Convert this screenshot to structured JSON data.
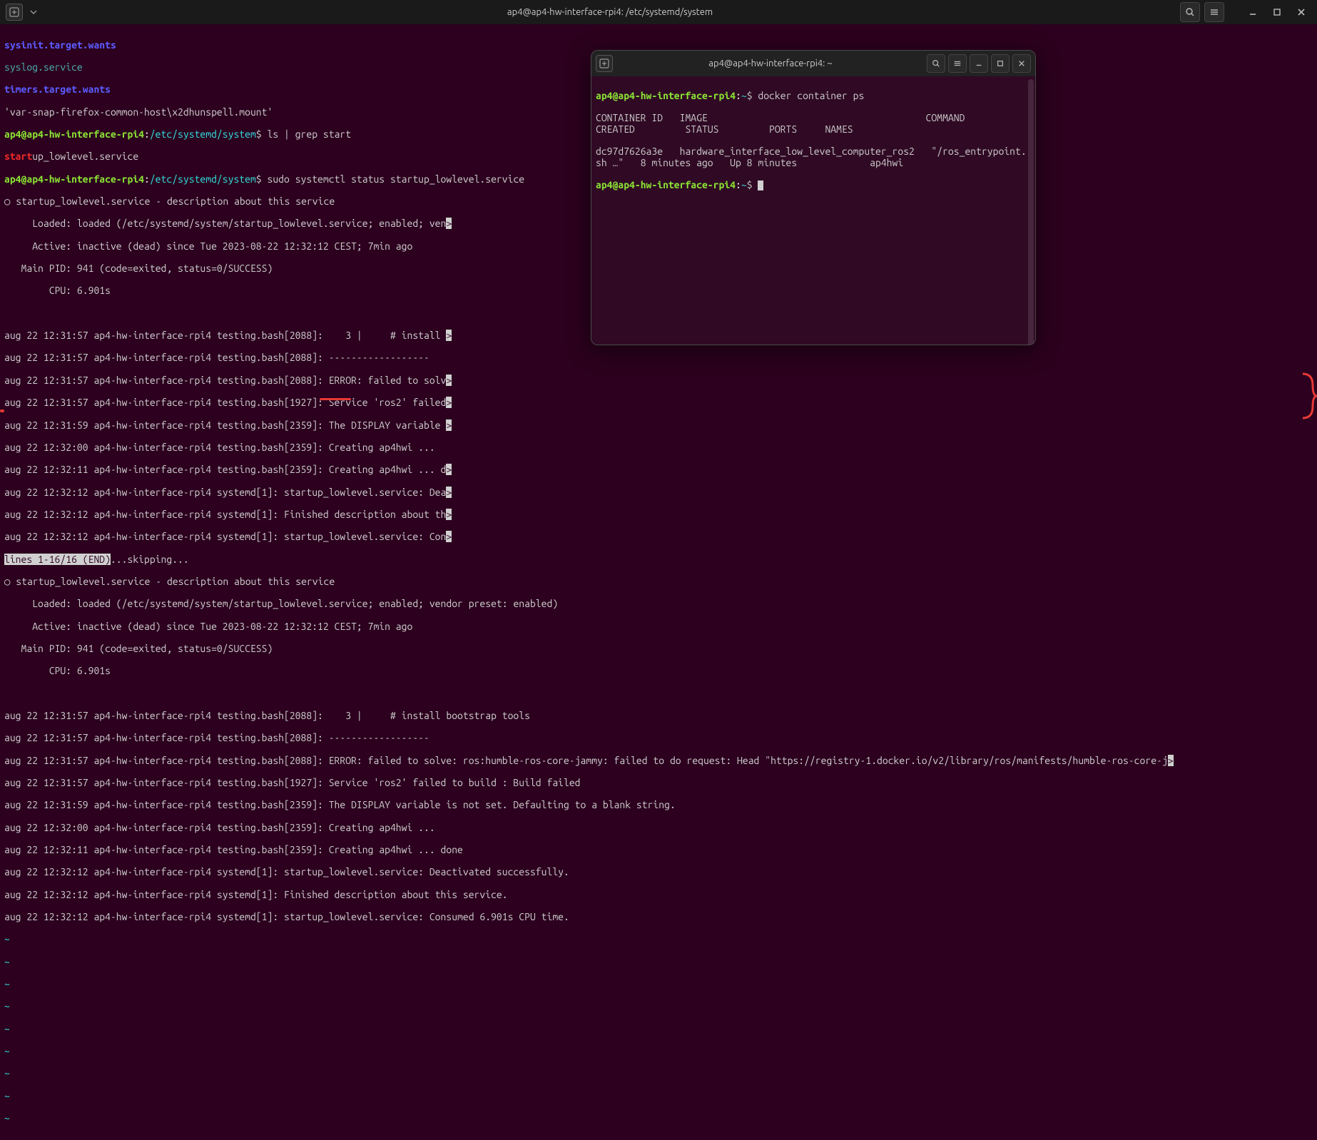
{
  "main_window": {
    "title": "ap4@ap4-hw-interface-rpi4: /etc/systemd/system",
    "prompt_user": "ap4@ap4-hw-interface-rpi4",
    "prompt_path": "/etc/systemd/system",
    "lines": {
      "l0": "sysinit.target.wants",
      "l1": "syslog.service",
      "l2": "timers.target.wants",
      "l3": "'var-snap-firefox-common-host\\x2dhunspell.mount'",
      "cmd1": "$ ls | grep start",
      "l4a": "start",
      "l4b": "up_lowlevel.service",
      "cmd2": "$ sudo systemctl status startup_lowlevel.service",
      "s_circle": "○ ",
      "s_title": "startup_lowlevel.service - description about this service",
      "s_loaded_a": "     Loaded: loaded (/etc/systemd/system/startup_lowlevel.service; enabled; ven",
      "s_active": "     Active: inactive (dead) since Tue 2023-08-22 12:32:12 CEST; 7min ago",
      "s_pid": "   Main PID: 941 (code=exited, status=0/SUCCESS)",
      "s_cpu": "        CPU: 6.901s",
      "log1": "aug 22 12:31:57 ap4-hw-interface-rpi4 testing.bash[2088]:    3 |     # install ",
      "log2": "aug 22 12:31:57 ap4-hw-interface-rpi4 testing.bash[2088]: ------------------",
      "log3": "aug 22 12:31:57 ap4-hw-interface-rpi4 testing.bash[2088]: ERROR: failed to solv",
      "log4": "aug 22 12:31:57 ap4-hw-interface-rpi4 testing.bash[1927]: Service 'ros2' failed",
      "log5": "aug 22 12:31:59 ap4-hw-interface-rpi4 testing.bash[2359]: The DISPLAY variable ",
      "log6": "aug 22 12:32:00 ap4-hw-interface-rpi4 testing.bash[2359]: Creating ap4hwi ...",
      "log7": "aug 22 12:32:11 ap4-hw-interface-rpi4 testing.bash[2359]: Creating ap4hwi ... d",
      "log8": "aug 22 12:32:12 ap4-hw-interface-rpi4 systemd[1]: startup_lowlevel.service: Dea",
      "log9": "aug 22 12:32:12 ap4-hw-interface-rpi4 systemd[1]: Finished description about th",
      "log10": "aug 22 12:32:12 ap4-hw-interface-rpi4 systemd[1]: startup_lowlevel.service: Con",
      "pager": "lines 1-16/16 (END)",
      "pager_suffix": "...skipping...",
      "s2_title": "startup_lowlevel.service - description about this service",
      "s2_loaded": "     Loaded: loaded (/etc/systemd/system/startup_lowlevel.service; enabled; vendor preset: enabled)",
      "s2_active": "     Active: inactive (dead) since Tue 2023-08-22 12:32:12 CEST; 7min ago",
      "s2_pid": "   Main PID: 941 (code=exited, status=0/SUCCESS)",
      "s2_cpu": "        CPU: 6.901s",
      "flog1": "aug 22 12:31:57 ap4-hw-interface-rpi4 testing.bash[2088]:    3 |     # install bootstrap tools",
      "flog2": "aug 22 12:31:57 ap4-hw-interface-rpi4 testing.bash[2088]: ------------------",
      "flog3": "aug 22 12:31:57 ap4-hw-interface-rpi4 testing.bash[2088]: ERROR: failed to solve: ros:humble-ros-core-jammy: failed to do request: Head \"https://registry-1.docker.io/v2/library/ros/manifests/humble-ros-core-j",
      "flog4": "aug 22 12:31:57 ap4-hw-interface-rpi4 testing.bash[1927]: Service 'ros2' failed to build : Build failed",
      "flog5": "aug 22 12:31:59 ap4-hw-interface-rpi4 testing.bash[2359]: The DISPLAY variable is not set. Defaulting to a blank string.",
      "flog6": "aug 22 12:32:00 ap4-hw-interface-rpi4 testing.bash[2359]: Creating ap4hwi ...",
      "flog7": "aug 22 12:32:11 ap4-hw-interface-rpi4 testing.bash[2359]: Creating ap4hwi ... done",
      "flog8": "aug 22 12:32:12 ap4-hw-interface-rpi4 systemd[1]: startup_lowlevel.service: Deactivated successfully.",
      "flog9": "aug 22 12:32:12 ap4-hw-interface-rpi4 systemd[1]: Finished description about this service.",
      "flog10": "aug 22 12:32:12 ap4-hw-interface-rpi4 systemd[1]: startup_lowlevel.service: Consumed 6.901s CPU time.",
      "tilde": "~"
    }
  },
  "second_window": {
    "title": "ap4@ap4-hw-interface-rpi4: ~",
    "prompt_user": "ap4@ap4-hw-interface-rpi4",
    "prompt_path": "~",
    "cmd": "$ docker container ps",
    "header": "CONTAINER ID   IMAGE                                       COMMAND                  CREATED         STATUS         PORTS     NAMES",
    "row": "dc97d7626a3e   hardware_interface_low_level_computer_ros2   \"/ros_entrypoint.sh …\"   8 minutes ago   Up 8 minutes             ap4hwi",
    "prompt2": "$ "
  }
}
